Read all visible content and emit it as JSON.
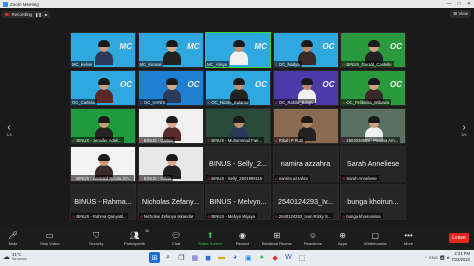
{
  "window": {
    "title": "Zoom Meeting",
    "controls": [
      "—",
      "□",
      "✕"
    ]
  },
  "recording": {
    "label": "Recording"
  },
  "view": {
    "label": "⊞ View"
  },
  "paging": {
    "left_num": "1/4",
    "right_num": "3/4"
  },
  "tiles": [
    {
      "name": "MC_Kelvin",
      "muted": false,
      "style": "video"
    },
    {
      "name": "MC_Kiranal",
      "muted": false,
      "style": "video"
    },
    {
      "name": "MC_Alisya",
      "muted": false,
      "style": "video"
    },
    {
      "name": "OC_Nadya",
      "muted": true,
      "style": "video"
    },
    {
      "name": "BINUS_Gerald_Castello",
      "muted": true,
      "style": "video"
    },
    {
      "name": "OC_Carissa",
      "muted": false,
      "style": "video"
    },
    {
      "name": "OC_HANIS",
      "muted": true,
      "style": "video"
    },
    {
      "name": "OC_Nicole_Sulamo",
      "muted": true,
      "style": "video"
    },
    {
      "name": "OC_Rahila_Balqis",
      "muted": true,
      "style": "video"
    },
    {
      "name": "OC_Felibelita_Wibawa",
      "muted": true,
      "style": "video"
    },
    {
      "name": "BINUS - Jennifer Adeli...",
      "muted": true,
      "style": "video"
    },
    {
      "name": "BINUS - Carina",
      "muted": true,
      "style": "video"
    },
    {
      "name": "BINUS - Muhammad Fari...",
      "muted": true,
      "style": "video"
    },
    {
      "name": "Rikah P Putri",
      "muted": true,
      "style": "video"
    },
    {
      "name": "2502028583 - Paulina Am...",
      "muted": true,
      "style": "video"
    },
    {
      "name": "BINUS - Leonard Nicola Jim...",
      "muted": true,
      "style": "video"
    },
    {
      "name": "BINUS - Olivia",
      "muted": true,
      "style": "video"
    },
    {
      "name": "BINUS - Selly_2501988115",
      "big": "BINUS - Selly_2...",
      "muted": true,
      "style": "text"
    },
    {
      "name": "namira azzahra",
      "big": "namira azzahra",
      "muted": true,
      "style": "text"
    },
    {
      "name": "Sarah Anneliese",
      "big": "Sarah Anneliese",
      "muted": true,
      "style": "text"
    },
    {
      "name": "BINUS - Rahma Qanyatil...",
      "big": "BINUS - Rahma...",
      "muted": true,
      "style": "text"
    },
    {
      "name": "Nicholas Zefanya Iskandar",
      "big": "Nicholas Zefany...",
      "muted": true,
      "style": "text"
    },
    {
      "name": "BINUS - Melvyn Wijaya",
      "big": "BINUS - Melvyn...",
      "muted": true,
      "style": "text"
    },
    {
      "name": "2540124293_Ivan Rizky S...",
      "big": "2540124293_Iv...",
      "muted": true,
      "style": "text"
    },
    {
      "name": "bunga khoirunnisa",
      "big": "bunga khoirun...",
      "muted": true,
      "style": "text"
    }
  ],
  "toolbar": {
    "mute": "Mute",
    "stop_video": "Stop Video",
    "security": "Security",
    "participants": "Participants",
    "participants_count": "36",
    "chat": "Chat",
    "share_screen": "Share Screen",
    "record": "Record",
    "breakout": "Breakout Rooms",
    "reactions": "Reactions",
    "apps": "Apps",
    "whiteboards": "Whiteboards",
    "more": "More",
    "end": "Leave"
  },
  "taskbar": {
    "temp": "31°C",
    "weather": "Berawan",
    "lang": "ENG",
    "time": "2:31 PM",
    "date": "7/22/2022"
  },
  "colors": {
    "accent_green": "#36c936",
    "end_red": "#e0281f",
    "zoom_blue": "#2d8cff"
  }
}
